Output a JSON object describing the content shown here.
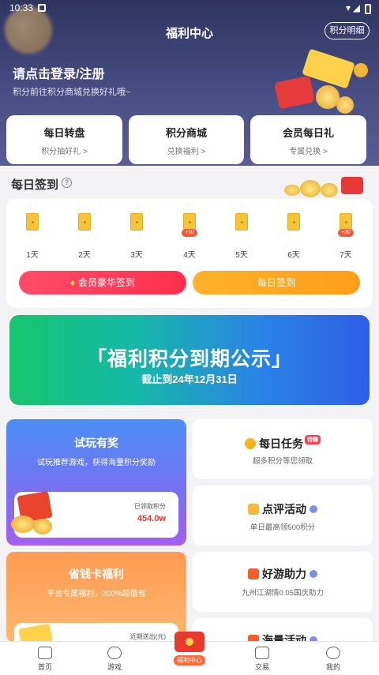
{
  "status_bar": {
    "time": "10:33"
  },
  "header": {
    "title": "福利中心",
    "points_detail_btn": "积分明细",
    "login_prompt": "请点击登录/注册",
    "login_sub": "积分前往积分商城兑换好礼哦~"
  },
  "quick_cards": [
    {
      "title": "每日转盘",
      "sub": "积分抽好礼 >"
    },
    {
      "title": "积分商城",
      "sub": "兑换福利 >"
    },
    {
      "title": "会员每日礼",
      "sub": "专属兑换 >"
    }
  ],
  "signin": {
    "title": "每日签到",
    "help_icon": "question-circle-icon",
    "days": [
      {
        "label": "1天",
        "bonus": ""
      },
      {
        "label": "2天",
        "bonus": ""
      },
      {
        "label": "3天",
        "bonus": ""
      },
      {
        "label": "4天",
        "bonus": "+10"
      },
      {
        "label": "5天",
        "bonus": ""
      },
      {
        "label": "6天",
        "bonus": ""
      },
      {
        "label": "7天",
        "bonus": "+30"
      }
    ],
    "vip_btn": "会员豪华签到",
    "daily_btn": "每日签到"
  },
  "banner": {
    "title": "「福利积分到期公示」",
    "subtitle": "截止到24年12月31日"
  },
  "cards": {
    "trial": {
      "title": "试玩有奖",
      "sub": "试玩推荐游戏，获得海量积分奖励",
      "label": "已领取积分",
      "value": "454.0w"
    },
    "savecard": {
      "title": "省钱卡福利",
      "sub": "平台专属福利，300%超值省",
      "label": "近期送出(元)"
    },
    "daily_task": {
      "title": "每日任务",
      "tag": "特赚",
      "sub": "超多积分等您领取"
    },
    "review": {
      "title": "点评活动",
      "sub": "单日最高领500积分"
    },
    "boost": {
      "title": "好游助力",
      "sub": "九州江湖情0.05国庆助力"
    },
    "mass": {
      "title": "海量活动"
    }
  },
  "nav": {
    "home": "首页",
    "games": "游戏",
    "welfare": "福利中心",
    "trade": "交易",
    "mine": "我的"
  },
  "colors": {
    "vip_btn": "#ff3b5c",
    "daily_btn": "#ffa51f",
    "accent_red": "#e8372b"
  }
}
